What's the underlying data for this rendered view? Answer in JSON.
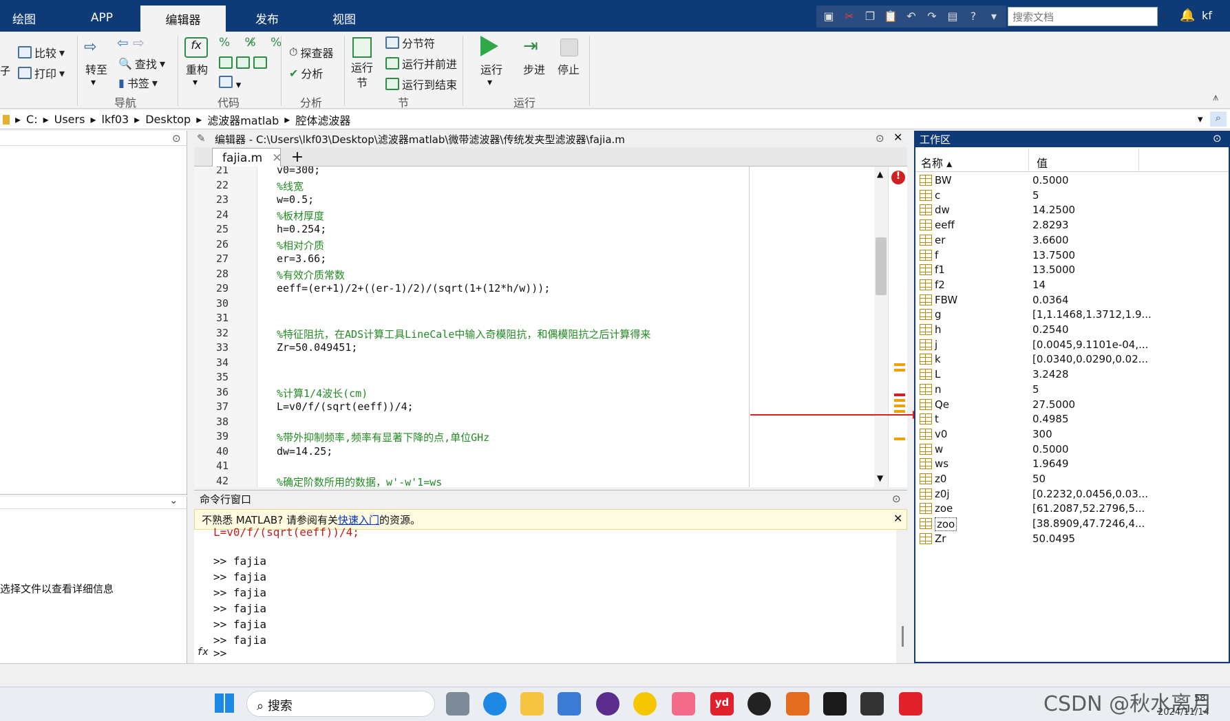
{
  "toptabs": [
    "绘图",
    "APP",
    "编辑器",
    "发布",
    "视图"
  ],
  "search_placeholder": "搜索文档",
  "user": "kf",
  "ribbon": {
    "compare": "比较",
    "print": "打印",
    "goto": "转至",
    "find": "查找",
    "bookmark": "书签",
    "refactor": "重构",
    "profiler": "探查器",
    "analyze": "分析",
    "run_section": "运行\n节",
    "section_break": "分节符",
    "run_advance": "运行并前进",
    "run_to_end": "运行到结束",
    "run": "运行",
    "step": "步进",
    "stop": "停止",
    "groups": {
      "nav": "导航",
      "code": "代码",
      "analysis": "分析",
      "section": "节",
      "run": "运行"
    },
    "left_cut": "子"
  },
  "path": [
    "C:",
    "Users",
    "lkf03",
    "Desktop",
    "滤波器matlab",
    "腔体滤波器"
  ],
  "editor": {
    "title": "编辑器 - C:\\Users\\lkf03\\Desktop\\滤波器matlab\\微带滤波器\\传统发夹型滤波器\\fajia.m",
    "file": "fajia.m"
  },
  "code": [
    {
      "n": "21",
      "t": "v0=300;",
      "c": false
    },
    {
      "n": "22",
      "t": "%线宽",
      "c": true
    },
    {
      "n": "23",
      "t": "w=0.5;",
      "c": false
    },
    {
      "n": "24",
      "t": "%板材厚度",
      "c": true
    },
    {
      "n": "25",
      "t": "h=0.254;",
      "c": false
    },
    {
      "n": "26",
      "t": "%相对介质",
      "c": true
    },
    {
      "n": "27",
      "t": "er=3.66;",
      "c": false
    },
    {
      "n": "28",
      "t": "%有效介质常数",
      "c": true
    },
    {
      "n": "29",
      "t": "eeff=(er+1)/2+((er-1)/2)/(sqrt(1+(12*h/w)));",
      "c": false
    },
    {
      "n": "30",
      "t": "",
      "c": false
    },
    {
      "n": "31",
      "t": "",
      "c": false
    },
    {
      "n": "32",
      "t": "%特征阻抗，在ADS计算工具LineCale中输入奇模阻抗，和偶模阻抗之后计算得来",
      "c": true
    },
    {
      "n": "33",
      "t": "Zr=50.049451;",
      "c": false
    },
    {
      "n": "34",
      "t": "",
      "c": false
    },
    {
      "n": "35",
      "t": "",
      "c": false
    },
    {
      "n": "36",
      "t": "%计算1/4波长(cm)",
      "c": true
    },
    {
      "n": "37",
      "t": "L=v0/f/(sqrt(eeff))/4;",
      "c": false
    },
    {
      "n": "38",
      "t": "",
      "c": false
    },
    {
      "n": "39",
      "t": "%带外抑制频率,频率有显著下降的点,单位GHz",
      "c": true
    },
    {
      "n": "40",
      "t": "dw=14.25;",
      "c": false
    },
    {
      "n": "41",
      "t": "",
      "c": false
    },
    {
      "n": "42",
      "t": "%确定阶数所用的数据，w'-w'1=ws",
      "c": true
    }
  ],
  "cmd": {
    "title": "命令行窗口",
    "notice_pre": "不熟悉 MATLAB? 请参阅有关",
    "notice_link": "快速入门",
    "notice_post": "的资源。",
    "cut_line": "L=v0/f/(sqrt(eeff))/4;",
    "lines": [
      ">> fajia",
      ">> fajia",
      ">> fajia",
      ">> fajia",
      ">> fajia",
      ">> fajia"
    ],
    "prompt": ">>"
  },
  "left_hint": "选择文件以查看详细信息",
  "workspace": {
    "title": "工作区",
    "col_name": "名称",
    "col_value": "值",
    "vars": [
      [
        "BW",
        "0.5000"
      ],
      [
        "c",
        "5"
      ],
      [
        "dw",
        "14.2500"
      ],
      [
        "eeff",
        "2.8293"
      ],
      [
        "er",
        "3.6600"
      ],
      [
        "f",
        "13.7500"
      ],
      [
        "f1",
        "13.5000"
      ],
      [
        "f2",
        "14"
      ],
      [
        "FBW",
        "0.0364"
      ],
      [
        "g",
        "[1,1.1468,1.3712,1.9..."
      ],
      [
        "h",
        "0.2540"
      ],
      [
        "j",
        "[0.0045,9.1101e-04,..."
      ],
      [
        "k",
        "[0.0340,0.0290,0.02..."
      ],
      [
        "L",
        "3.2428"
      ],
      [
        "n",
        "5"
      ],
      [
        "Qe",
        "27.5000"
      ],
      [
        "t",
        "0.4985"
      ],
      [
        "v0",
        "300"
      ],
      [
        "w",
        "0.5000"
      ],
      [
        "ws",
        "1.9649"
      ],
      [
        "z0",
        "50"
      ],
      [
        "z0j",
        "[0.2232,0.0456,0.03..."
      ],
      [
        "zoe",
        "[61.2087,52.2796,5..."
      ],
      [
        "zoo",
        "[38.8909,47.7246,4..."
      ],
      [
        "Zr",
        "50.0495"
      ]
    ]
  },
  "taskbar": {
    "search": "搜索",
    "time": "58",
    "date": "2024/11/14"
  },
  "watermark": "CSDN @秋水离月"
}
